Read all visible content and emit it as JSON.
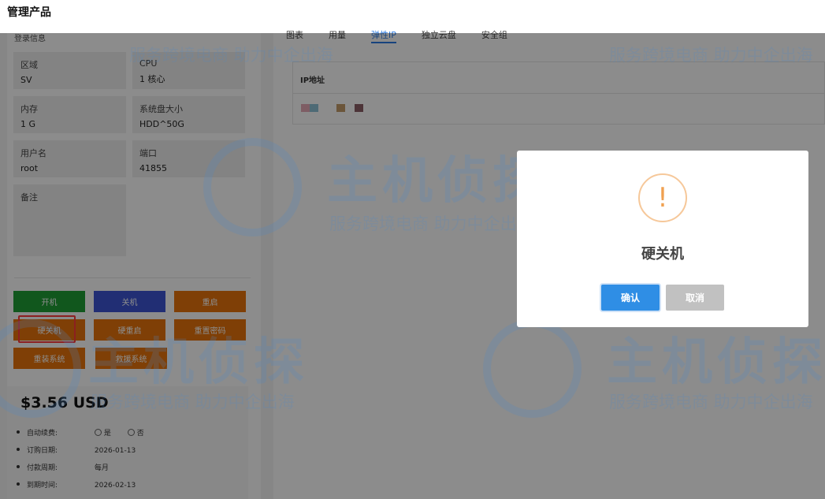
{
  "header": {
    "title": "管理产品"
  },
  "login_info": {
    "title": "登录信息",
    "fields": [
      {
        "label": "区域",
        "value": "SV"
      },
      {
        "label": "CPU",
        "value": "1 核心"
      },
      {
        "label": "内存",
        "value": "1 G"
      },
      {
        "label": "系统盘大小",
        "value": "HDD^50G"
      },
      {
        "label": "用户名",
        "value": "root"
      },
      {
        "label": "端口",
        "value": "41855"
      },
      {
        "label": "备注",
        "value": ""
      }
    ]
  },
  "actions": {
    "power_on": "开机",
    "shutdown": "关机",
    "restart": "重启",
    "hard_shutdown": "硬关机",
    "hard_restart": "硬重启",
    "reset_password": "重置密码",
    "reinstall": "重装系统",
    "rescue": "救援系统"
  },
  "billing": {
    "price": "$3.56 USD",
    "auto_renew_label": "自动续费:",
    "yes": "是",
    "no": "否",
    "rows": [
      {
        "label": "订购日期:",
        "value": "2026-01-13"
      },
      {
        "label": "付款周期:",
        "value": "每月"
      },
      {
        "label": "到期时间:",
        "value": "2026-02-13"
      }
    ]
  },
  "tabs": [
    {
      "label": "图表"
    },
    {
      "label": "用量"
    },
    {
      "label": "弹性IP"
    },
    {
      "label": "独立云盘"
    },
    {
      "label": "安全组"
    }
  ],
  "active_tab": 2,
  "ip_table": {
    "header": "IP地址"
  },
  "dialog": {
    "icon_glyph": "!",
    "title": "硬关机",
    "confirm": "确认",
    "cancel": "取消"
  },
  "watermark": {
    "big": "主机侦探",
    "small": "服务跨境电商 助力中企出海"
  },
  "colors": {
    "accent": "#2a7be4",
    "green": "#1f9e35",
    "blue": "#3c55d4",
    "orange": "#e8740c",
    "highlight": "#ff3b3b",
    "overlay": "rgba(0,0,0,0.45)"
  }
}
